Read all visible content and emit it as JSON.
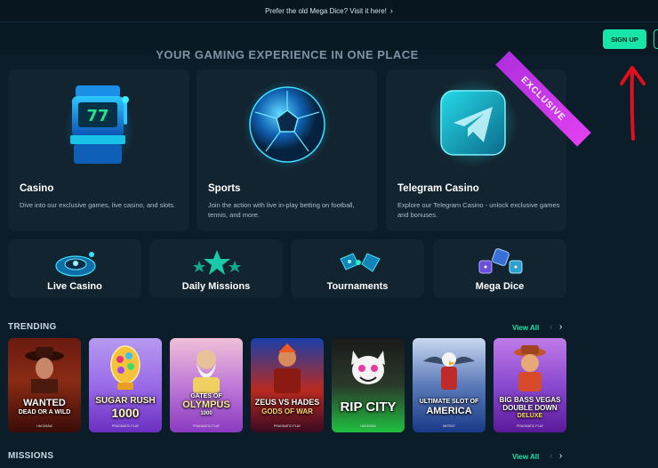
{
  "topbar": {
    "text": "Prefer the old Mega Dice? Visit it here!",
    "chevron_icon": "chevron-right-icon"
  },
  "header": {
    "signup_label": "SIGN UP",
    "accent": "#17e6a8"
  },
  "heading": "YOUR GAMING EXPERIENCE IN ONE PLACE",
  "categories": [
    {
      "title": "Casino",
      "desc": "Dive into our exclusive games, live casino, and slots.",
      "icon": "slot-machine-icon"
    },
    {
      "title": "Sports",
      "desc": "Join the action with live in-play betting on football, tennis, and more.",
      "icon": "soccer-ball-icon"
    },
    {
      "title": "Telegram Casino",
      "desc": "Explore our Telegram Casino - unlock exclusive games and bonuses.",
      "icon": "telegram-icon",
      "badge": "EXCLUSIVE"
    }
  ],
  "shortcuts": [
    {
      "label": "Live Casino",
      "icon": "roulette-icon"
    },
    {
      "label": "Daily Missions",
      "icon": "stars-icon"
    },
    {
      "label": "Tournaments",
      "icon": "controller-icon"
    },
    {
      "label": "Mega Dice",
      "icon": "dice-icon"
    }
  ],
  "trending": {
    "title": "TRENDING",
    "view_all": "View All",
    "games": [
      {
        "title": "WANTED",
        "subtitle": "DEAD OR A WILD",
        "provider": "HACKSAW"
      },
      {
        "title": "SUGAR RUSH",
        "subtitle": "1000",
        "provider": "PRAGMATIC PLAY"
      },
      {
        "title": "GATES OF",
        "subtitle": "OLYMPUS",
        "extra": "1000",
        "provider": "PRAGMATIC PLAY"
      },
      {
        "title": "ZEUS VS HADES",
        "subtitle": "GODS OF WAR",
        "provider": "PRAGMATIC PLAY"
      },
      {
        "title": "RIP CITY",
        "subtitle": "",
        "provider": "HACKSAW"
      },
      {
        "title": "ULTIMATE SLOT OF",
        "subtitle": "AMERICA",
        "provider": "NETENT"
      },
      {
        "title": "BIG BASS VEGAS",
        "subtitle": "DOUBLE DOWN",
        "extra": "DELUXE",
        "provider": "PRAGMATIC PLAY"
      }
    ]
  },
  "missions": {
    "title": "MISSIONS",
    "view_all": "View All"
  }
}
